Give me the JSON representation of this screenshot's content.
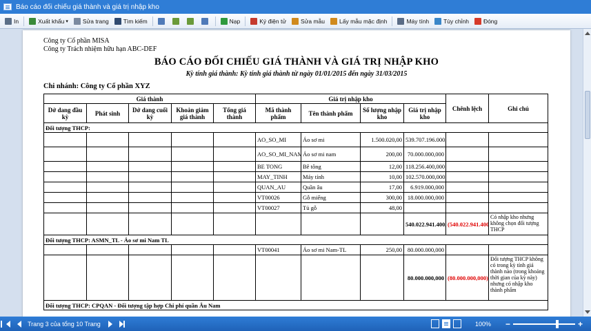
{
  "window": {
    "title": "Báo cáo đối chiếu giá thành và giá trị nhập kho"
  },
  "toolbar": [
    {
      "name": "print-button",
      "label": "In",
      "icon": "printer-icon",
      "color": "#5b6f88"
    },
    {
      "name": "export-button",
      "label": "Xuất khẩu",
      "icon": "export-icon",
      "color": "#3a8a3a",
      "dropdown": true
    },
    {
      "name": "edit-page-button",
      "label": "Sửa trang",
      "icon": "page-edit-icon",
      "color": "#7b8aa0"
    },
    {
      "name": "search-button",
      "label": "Tìm kiếm",
      "icon": "binoculars-icon",
      "color": "#304a70"
    },
    {
      "name": "view1-button",
      "label": "",
      "icon": "grid-icon",
      "color": "#4f7ab8"
    },
    {
      "name": "view2-button",
      "label": "",
      "icon": "page-icon",
      "color": "#6a9a3a"
    },
    {
      "name": "view3-button",
      "label": "",
      "icon": "page-icon",
      "color": "#6a9a3a"
    },
    {
      "name": "view4-button",
      "label": "",
      "icon": "grid-icon",
      "color": "#4f7ab8"
    },
    {
      "name": "load-button",
      "label": "Nạp",
      "icon": "refresh-icon",
      "color": "#2e9a3e"
    },
    {
      "name": "sign-button",
      "label": "Ký điện tử",
      "icon": "signature-icon",
      "color": "#c53a2e"
    },
    {
      "name": "edit-template-button",
      "label": "Sửa mẫu",
      "icon": "template-edit-icon",
      "color": "#d08a1e"
    },
    {
      "name": "default-template-button",
      "label": "Lấy mẫu mặc định",
      "icon": "template-icon",
      "color": "#d08a1e"
    },
    {
      "name": "calculator-button",
      "label": "Máy tính",
      "icon": "calculator-icon",
      "color": "#5a6c86"
    },
    {
      "name": "customize-button",
      "label": "Tùy chỉnh",
      "icon": "customize-icon",
      "color": "#3a86c8"
    },
    {
      "name": "close-button",
      "label": "Đóng",
      "icon": "close-icon",
      "color": "#d63a2a"
    }
  ],
  "report": {
    "company1": "Công ty Cổ phần MISA",
    "company2": "Công ty Trách nhiệm hữu hạn ABC-DEF",
    "title": "BÁO CÁO ĐỐI CHIẾU GIÁ THÀNH VÀ GIÁ TRỊ NHẬP KHO",
    "subtitle": "Kỳ tính giá thành: Kỳ tính giá thành từ ngày 01/01/2015 đến ngày 31/03/2015",
    "branch": "Chi nhánh: Công ty Cổ phần XYZ",
    "headers": {
      "cost_group": "Giá thành",
      "stock_group": "Giá trị nhập kho",
      "diff": "Chênh lệch",
      "note": "Ghi chú",
      "cost_cols": [
        "Dở dang đầu kỳ",
        "Phát sinh",
        "Dở dang cuối kỳ",
        "Khoản giảm giá thành",
        "Tổng giá thành"
      ],
      "stock_cols": [
        "Mã thành phẩm",
        "Tên thành phẩm",
        "Số lượng nhập kho",
        "Giá trị nhập kho"
      ]
    },
    "groups": [
      {
        "label": "Đối tượng THCP:",
        "rows": [
          {
            "code": "AO_SO_MI",
            "name": "Áo sơ mi",
            "qty": "1.500.020,00",
            "value": "539.707.196.000,000"
          },
          {
            "code": "AO_SO_MI_NAM",
            "name": "Áo sơ mi nam",
            "qty": "200,00",
            "value": "70.000.000,000"
          },
          {
            "code": "BE TONG",
            "name": "Bê tông",
            "qty": "12,00",
            "value": "118.256.400,000"
          },
          {
            "code": "MAY_TINH",
            "name": "Máy tính",
            "qty": "10,00",
            "value": "102.570.000,000"
          },
          {
            "code": "QUAN_AU",
            "name": "Quần âu",
            "qty": "17,00",
            "value": "6.919.000,000"
          },
          {
            "code": "VT00026",
            "name": "Gỗ miếng",
            "qty": "300,00",
            "value": "18.000.000,000"
          },
          {
            "code": "VT00027",
            "name": "Tủ gỗ",
            "qty": "48,00",
            "value": ""
          }
        ],
        "total": {
          "value": "540.022.941.400,000",
          "diff": "(540.022.941.400,000)",
          "note": "Có nhập kho nhưng không chọn đối tượng THCP"
        }
      },
      {
        "label": "Đối tượng THCP:  ASMN_TL - Áo sơ mi Nam TL",
        "rows": [
          {
            "code": "VT00041",
            "name": "Áo sơ mi Nam-TL",
            "qty": "250,00",
            "value": "80.000.000,000"
          }
        ],
        "total": {
          "value": "80.000.000,000",
          "diff": "(80.000.000,000)",
          "note": "Đối tượng THCP không có trong kỳ tính giá thành nào (trong khoảng thời gian của kỳ này) nhưng có nhập kho thành phẩm"
        }
      },
      {
        "label": "Đối tượng THCP:  CPQAN - Đối tượng tập hợp Chi phí quần Âu Nam",
        "rows": [],
        "total": null
      }
    ]
  },
  "status": {
    "page_info": "Trang 3 của tổng 10 Trang",
    "zoom": "100%",
    "zoom_level": 0.72
  }
}
